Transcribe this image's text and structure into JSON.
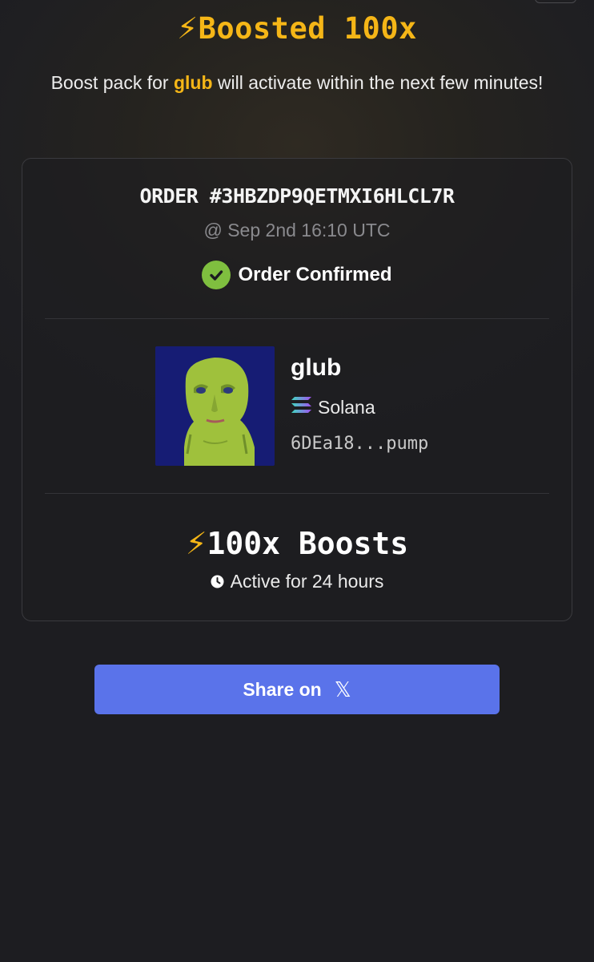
{
  "header": {
    "bolt": "⚡",
    "title": "Boosted 100x",
    "subtitle_prefix": "Boost pack for ",
    "token": "glub",
    "subtitle_suffix": " will activate within the next few minutes!"
  },
  "order": {
    "id": "ORDER #3HBZDP9QETMXI6HLCL7R",
    "time": "@ Sep 2nd 16:10 UTC",
    "status": "Order Confirmed",
    "status_color": "#7fbf3f"
  },
  "token": {
    "name": "glub",
    "chain": "Solana",
    "address": "6DEa18...pump",
    "image_icon": "token-avatar"
  },
  "boost": {
    "bolt": "⚡",
    "label": "100x Boosts",
    "duration": "Active for 24 hours"
  },
  "share": {
    "label": "Share on",
    "icon": "𝕏",
    "color": "#5a73ea"
  },
  "colors": {
    "accent": "#f5b617",
    "background": "#1f1f22"
  }
}
